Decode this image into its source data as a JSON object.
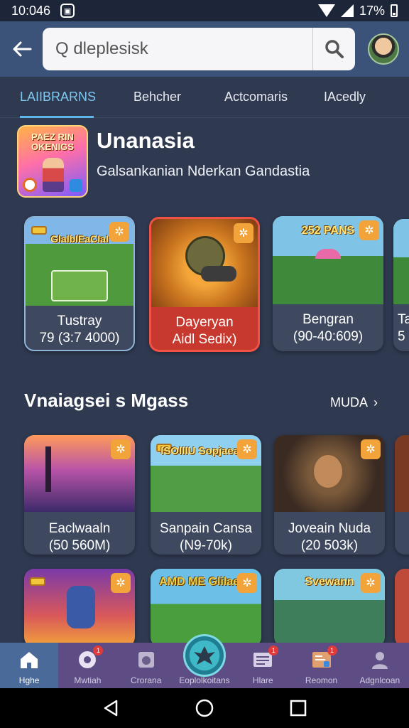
{
  "status_bar": {
    "time": "10:046",
    "battery": "17%"
  },
  "header": {
    "search_value": "Q dleplesisk"
  },
  "tabs": [
    {
      "label": "LAIIBRARNS",
      "active": true
    },
    {
      "label": "Behcher",
      "active": false
    },
    {
      "label": "Actcomaris",
      "active": false
    },
    {
      "label": "IAcedly",
      "active": false
    }
  ],
  "featured": {
    "thumb_title": "PAEZ RIN OKENIGS",
    "title": "Unanasia",
    "subtitle": "Galsankanian Nderkan Gandastia"
  },
  "row1": [
    {
      "thumb_title": "GlaIbIEaCIaI",
      "name": "Tustray",
      "size": "79 (3:7 4000)"
    },
    {
      "thumb_title": "",
      "name": "Dayeryan",
      "size": "Aidl Sedix)"
    },
    {
      "thumb_title": "252 PANS",
      "name": "Bengran",
      "size": "(90-40:609)"
    },
    {
      "thumb_title": "",
      "name": "Ta",
      "size": "5"
    }
  ],
  "section": {
    "title": "Vnaiagsei s Mgass",
    "more": "MUDA"
  },
  "row2": [
    {
      "thumb_title": "",
      "name": "Eaclwaaln",
      "size": "(50 560M)"
    },
    {
      "thumb_title": "ISOIIIU Sopjaeasy",
      "name": "Sanpain Cansa",
      "size": "(N9-70k)"
    },
    {
      "thumb_title": "",
      "name": "Joveain Nuda",
      "size": "(20 503k)"
    },
    {
      "thumb_title": "",
      "name": "",
      "size": ""
    }
  ],
  "row3": [
    {
      "thumb_title": ""
    },
    {
      "thumb_title": "AMD ME Glilaena"
    },
    {
      "thumb_title": "Svewann"
    },
    {
      "thumb_title": ""
    }
  ],
  "bottom_nav": [
    {
      "label": "Hghe",
      "icon": "home-icon",
      "active": true,
      "badge": ""
    },
    {
      "label": "Mwtiah",
      "icon": "disc-icon",
      "active": false,
      "badge": "1"
    },
    {
      "label": "Crorana",
      "icon": "camera-icon",
      "active": false,
      "badge": ""
    },
    {
      "label": "Eoplolkoitans",
      "icon": "explore-icon",
      "active": false,
      "badge": ""
    },
    {
      "label": "Hlare",
      "icon": "list-icon",
      "active": false,
      "badge": "1"
    },
    {
      "label": "Reomon",
      "icon": "board-icon",
      "active": false,
      "badge": "1"
    },
    {
      "label": "Adgnlcoan",
      "icon": "person-icon",
      "active": false,
      "badge": ""
    }
  ],
  "colors": {
    "background": "#2f3950",
    "header": "#3b5378",
    "tab_active": "#7ec8f0",
    "selected_card": "#c7382e",
    "bottom_nav": "#5d4d84",
    "gear_badge": "#f2a33a"
  }
}
